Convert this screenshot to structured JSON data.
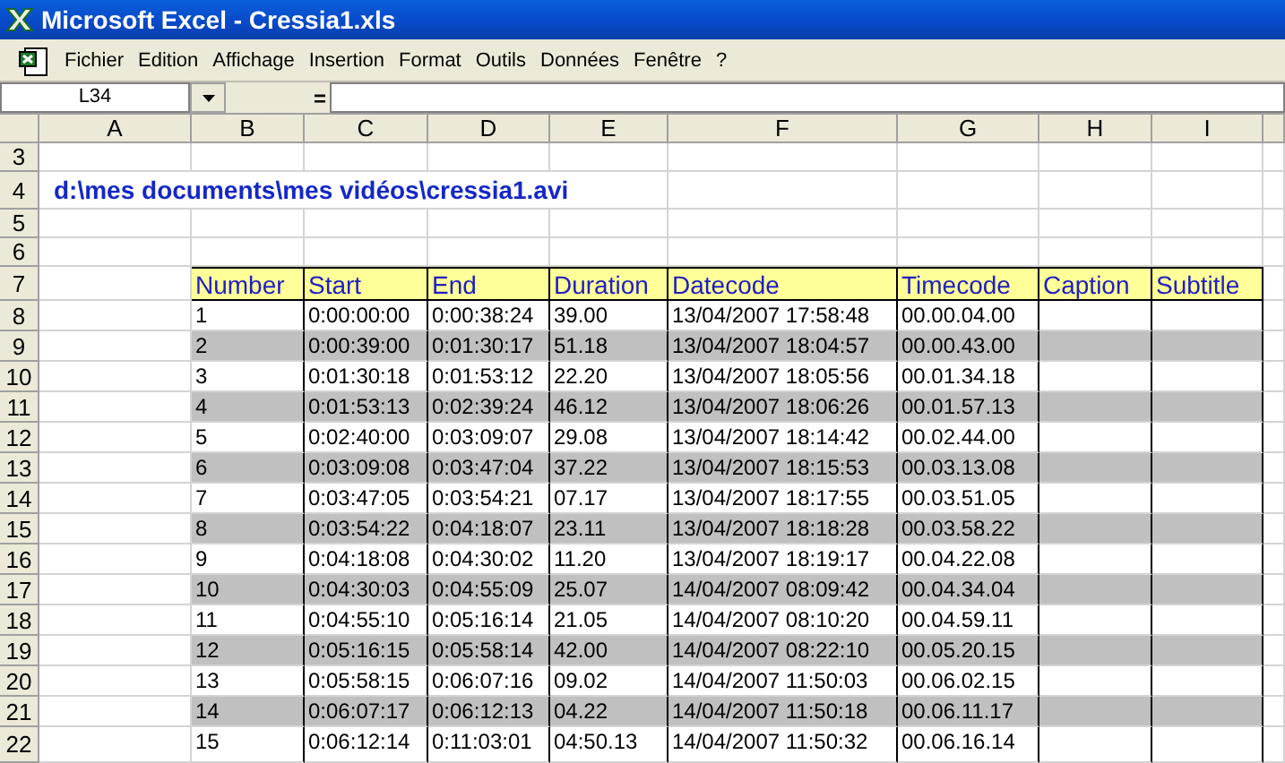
{
  "window": {
    "title": "Microsoft Excel - Cressia1.xls"
  },
  "menu": [
    "Fichier",
    "Edition",
    "Affichage",
    "Insertion",
    "Format",
    "Outils",
    "Données",
    "Fenêtre",
    "?"
  ],
  "formula_bar": {
    "name_box": "L34",
    "equals": "="
  },
  "columns": [
    "A",
    "B",
    "C",
    "D",
    "E",
    "F",
    "G",
    "H",
    "I"
  ],
  "rows": [
    {
      "row": "3",
      "kind": "blank"
    },
    {
      "row": "4",
      "kind": "title",
      "text": "d:\\mes documents\\mes vidéos\\cressia1.avi"
    },
    {
      "row": "5",
      "kind": "blank"
    },
    {
      "row": "6",
      "kind": "blank"
    },
    {
      "row": "7",
      "kind": "header",
      "cells": [
        "Number",
        "Start",
        "End",
        "Duration",
        "Datecode",
        "Timecode",
        "Caption",
        "Subtitle"
      ]
    },
    {
      "row": "8",
      "kind": "data",
      "shaded": false,
      "cells": [
        "1",
        "0:00:00:00",
        "0:00:38:24",
        "39.00",
        "13/04/2007 17:58:48",
        "00.00.04.00"
      ]
    },
    {
      "row": "9",
      "kind": "data",
      "shaded": true,
      "cells": [
        "2",
        "0:00:39:00",
        "0:01:30:17",
        "51.18",
        "13/04/2007 18:04:57",
        "00.00.43.00"
      ]
    },
    {
      "row": "10",
      "kind": "data",
      "shaded": false,
      "cells": [
        "3",
        "0:01:30:18",
        "0:01:53:12",
        "22.20",
        "13/04/2007 18:05:56",
        "00.01.34.18"
      ]
    },
    {
      "row": "11",
      "kind": "data",
      "shaded": true,
      "cells": [
        "4",
        "0:01:53:13",
        "0:02:39:24",
        "46.12",
        "13/04/2007 18:06:26",
        "00.01.57.13"
      ]
    },
    {
      "row": "12",
      "kind": "data",
      "shaded": false,
      "cells": [
        "5",
        "0:02:40:00",
        "0:03:09:07",
        "29.08",
        "13/04/2007 18:14:42",
        "00.02.44.00"
      ]
    },
    {
      "row": "13",
      "kind": "data",
      "shaded": true,
      "cells": [
        "6",
        "0:03:09:08",
        "0:03:47:04",
        "37.22",
        "13/04/2007 18:15:53",
        "00.03.13.08"
      ]
    },
    {
      "row": "14",
      "kind": "data",
      "shaded": false,
      "cells": [
        "7",
        "0:03:47:05",
        "0:03:54:21",
        "07.17",
        "13/04/2007 18:17:55",
        "00.03.51.05"
      ]
    },
    {
      "row": "15",
      "kind": "data",
      "shaded": true,
      "cells": [
        "8",
        "0:03:54:22",
        "0:04:18:07",
        "23.11",
        "13/04/2007 18:18:28",
        "00.03.58.22"
      ]
    },
    {
      "row": "16",
      "kind": "data",
      "shaded": false,
      "cells": [
        "9",
        "0:04:18:08",
        "0:04:30:02",
        "11.20",
        "13/04/2007 18:19:17",
        "00.04.22.08"
      ]
    },
    {
      "row": "17",
      "kind": "data",
      "shaded": true,
      "cells": [
        "10",
        "0:04:30:03",
        "0:04:55:09",
        "25.07",
        "14/04/2007 08:09:42",
        "00.04.34.04"
      ]
    },
    {
      "row": "18",
      "kind": "data",
      "shaded": false,
      "cells": [
        "11",
        "0:04:55:10",
        "0:05:16:14",
        "21.05",
        "14/04/2007 08:10:20",
        "00.04.59.11"
      ]
    },
    {
      "row": "19",
      "kind": "data",
      "shaded": true,
      "cells": [
        "12",
        "0:05:16:15",
        "0:05:58:14",
        "42.00",
        "14/04/2007 08:22:10",
        "00.05.20.15"
      ]
    },
    {
      "row": "20",
      "kind": "data",
      "shaded": false,
      "cells": [
        "13",
        "0:05:58:15",
        "0:06:07:16",
        "09.02",
        "14/04/2007 11:50:03",
        "00.06.02.15"
      ]
    },
    {
      "row": "21",
      "kind": "data",
      "shaded": true,
      "cells": [
        "14",
        "0:06:07:17",
        "0:06:12:13",
        "04.22",
        "14/04/2007 11:50:18",
        "00.06.11.17"
      ]
    },
    {
      "row": "22",
      "kind": "data",
      "shaded": false,
      "cells": [
        "15",
        "0:06:12:14",
        "0:11:03:01",
        "04:50.13",
        "14/04/2007 11:50:32",
        "00.06.16.14"
      ]
    }
  ]
}
